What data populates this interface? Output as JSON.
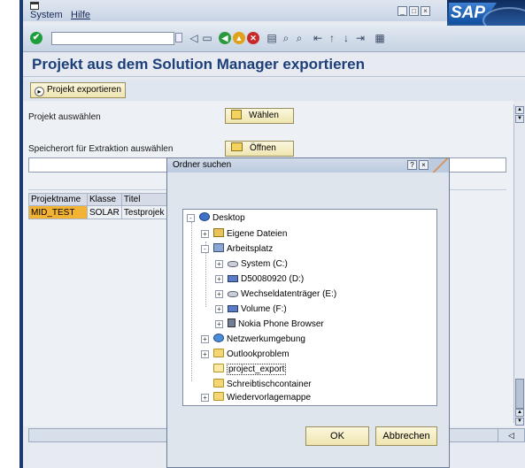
{
  "menu": {
    "system_label": "System",
    "help_label": "Hilfe"
  },
  "window_buttons": [
    "_",
    "□",
    "×"
  ],
  "brand": {
    "logo_text": "SAP",
    "accent_color": "#0f2b5c"
  },
  "toolbar": {
    "enter_icon": "check-icon",
    "command_field_value": "",
    "icons": [
      "back-icon",
      "save-icon",
      "nav-back-icon",
      "exit-icon",
      "cancel-icon",
      "print-icon",
      "find-icon",
      "find-next-icon",
      "first-page-icon",
      "prev-page-icon",
      "next-page-icon",
      "last-page-icon",
      "layout-icon"
    ]
  },
  "page": {
    "title": "Projekt aus dem Solution Manager exportieren"
  },
  "app_toolbar": {
    "export_button_label": "Projekt exportieren"
  },
  "form": {
    "select_project_label": "Projekt auswählen",
    "select_button_label": "Wählen",
    "storage_label": "Speicherort für Extraktion auswählen",
    "open_button_label": "Öffnen",
    "storage_value": ""
  },
  "table": {
    "headers": [
      "Projektname",
      "Klasse",
      "Titel"
    ],
    "rows": [
      [
        "MID_TEST",
        "SOLAR",
        "Testprojek"
      ]
    ]
  },
  "dialog": {
    "title": "Ordner suchen",
    "title_buttons": [
      "?",
      "×"
    ],
    "tree": [
      {
        "label": "Desktop",
        "icon": "desktop-icon",
        "expander": "-"
      },
      {
        "label": "Eigene Dateien",
        "icon": "documents-folder-icon",
        "expander": "+"
      },
      {
        "label": "Arbeitsplatz",
        "icon": "computer-icon",
        "expander": "-"
      },
      {
        "label": "System (C:)",
        "icon": "drive-icon",
        "expander": "+"
      },
      {
        "label": "D50080920 (D:)",
        "icon": "network-drive-icon",
        "expander": "+"
      },
      {
        "label": "Wechseldatenträger (E:)",
        "icon": "drive-icon",
        "expander": "+"
      },
      {
        "label": "Volume (F:)",
        "icon": "drive-icon",
        "expander": "+"
      },
      {
        "label": "Nokia Phone Browser",
        "icon": "phone-icon",
        "expander": "+"
      },
      {
        "label": "Netzwerkumgebung",
        "icon": "network-icon",
        "expander": "+"
      },
      {
        "label": "Outlookproblem",
        "icon": "folder-icon",
        "expander": "+"
      },
      {
        "label": "project_export",
        "icon": "folder-open-icon",
        "expander": "",
        "selected": true
      },
      {
        "label": "Schreibtischcontainer",
        "icon": "folder-icon",
        "expander": ""
      },
      {
        "label": "Wiedervorlagemappe",
        "icon": "folder-icon",
        "expander": "+"
      }
    ],
    "ok_label": "OK",
    "cancel_label": "Abbrechen"
  },
  "status": {
    "segment_text": "◁"
  }
}
